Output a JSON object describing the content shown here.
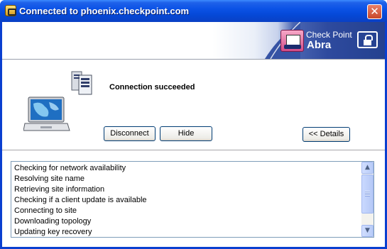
{
  "window": {
    "title": "Connected to phoenix.checkpoint.com",
    "close_symbol": "✕"
  },
  "banner": {
    "brand_line1": "Check Point",
    "brand_line2": "Abra",
    "logo_icon": "abra-logo-icon",
    "lock_icon": "lock-icon"
  },
  "status": {
    "message": "Connection succeeded"
  },
  "buttons": {
    "disconnect": "Disconnect",
    "hide": "Hide",
    "details": "<< Details"
  },
  "log": {
    "items": [
      "Checking for network availability",
      "Resolving site name",
      "Retrieving site information",
      "Checking if a client update is available",
      "Connecting to site",
      "Downloading topology",
      "Updating key recovery"
    ],
    "scroll_up_symbol": "▲",
    "scroll_down_symbol": "▼"
  },
  "colors": {
    "titlebar": "#0548d6",
    "banner_blue": "#2e4a9e",
    "button_border": "#003c74"
  }
}
